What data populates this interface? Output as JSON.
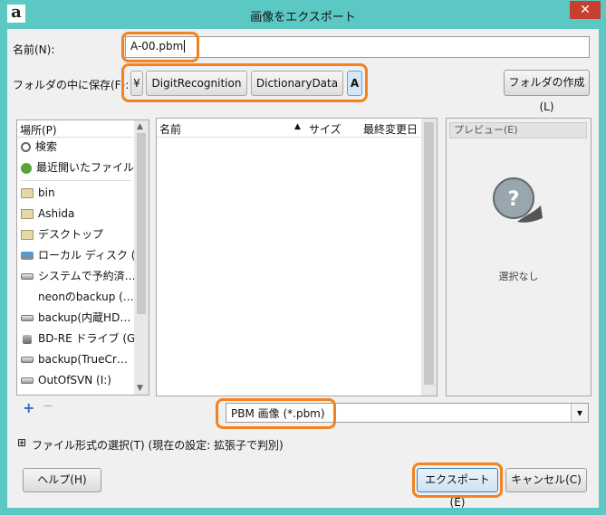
{
  "window": {
    "title": "画像をエクスポート",
    "app_icon": "a",
    "close_symbol": "✕"
  },
  "name_label": "名前(N):",
  "filename_value": "A-00.pbm",
  "save_in_label": "フォルダの中に保存(F):",
  "breadcrumb": {
    "root": "¥",
    "items": [
      "DigitRecognition",
      "DictionaryData",
      "A"
    ]
  },
  "create_folder_label": "フォルダの作成(L)",
  "places": {
    "header": "場所(P)",
    "items": [
      {
        "label": "検索",
        "icon": "search-icon"
      },
      {
        "label": "最近開いたファイル",
        "icon": "recent-icon"
      },
      {
        "label": "bin",
        "icon": "folder-icon"
      },
      {
        "label": "Ashida",
        "icon": "folder-icon"
      },
      {
        "label": "デスクトップ",
        "icon": "folder-icon"
      },
      {
        "label": "ローカル ディスク (C:)",
        "icon": "local-disk-icon"
      },
      {
        "label": "システムで予約済…",
        "icon": "drive-icon"
      },
      {
        "label": "neonのbackup (…",
        "icon": ""
      },
      {
        "label": "backup(内蔵HD…",
        "icon": "drive-icon"
      },
      {
        "label": "BD-RE ドライブ (G:)",
        "icon": "optical-drive-icon"
      },
      {
        "label": "backup(TrueCr…",
        "icon": "drive-icon"
      },
      {
        "label": "OutOfSVN (I:)",
        "icon": "drive-icon"
      }
    ],
    "add_symbol": "+",
    "remove_symbol": "—"
  },
  "files": {
    "col_name": "名前",
    "col_size": "サイズ",
    "col_modified": "最終変更日",
    "sort_arrow": "▲"
  },
  "preview": {
    "label": "プレビュー(E)",
    "none_text": "選択なし"
  },
  "filetype": {
    "selected": "PBM 画像 (*.pbm)",
    "dropdown_symbol": "▾"
  },
  "select_filetype": {
    "expander": "⊞",
    "label": "ファイル形式の選択(T) (現在の設定: 拡張子で判別)"
  },
  "buttons": {
    "help": "ヘルプ(H)",
    "export": "エクスポート(E)",
    "cancel": "キャンセル(C)"
  },
  "colors": {
    "titlebar": "#5bc8c4",
    "highlight": "#f58220",
    "close": "#c7402f"
  }
}
